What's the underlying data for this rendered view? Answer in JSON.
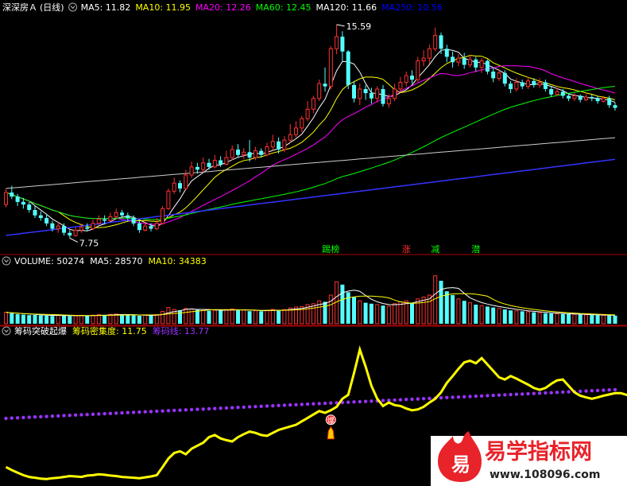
{
  "header": {
    "stock_name": "深深房Ａ",
    "period": "(日线)",
    "ma_items": [
      {
        "label": "MA5: 11.82",
        "color": "#ffffff"
      },
      {
        "label": "MA10: 11.95",
        "color": "#ffff00"
      },
      {
        "label": "MA20: 12.26",
        "color": "#ff00ff"
      },
      {
        "label": "MA60: 12.45",
        "color": "#00ff00"
      },
      {
        "label": "MA120: 11.66",
        "color": "#ffffff"
      },
      {
        "label": "MA250: 10.56",
        "color": "#0000ff"
      }
    ]
  },
  "annotations": {
    "high": "15.59",
    "low": "7.75"
  },
  "signals": [
    {
      "text": "踢榜",
      "color": "#00ff00",
      "bar": 56
    },
    {
      "text": "涨",
      "color": "#ff3030",
      "bar": 69
    },
    {
      "text": "减",
      "color": "#00ff00",
      "bar": 74
    },
    {
      "text": "潜",
      "color": "#00ff00",
      "bar": 81
    }
  ],
  "volume_header": {
    "items": [
      {
        "label": "VOLUME: 50274",
        "color": "#ffffff"
      },
      {
        "label": "MA5: 28570",
        "color": "#ffffff"
      },
      {
        "label": "MA10: 34383",
        "color": "#ffff00"
      }
    ]
  },
  "indicator_header": {
    "items": [
      {
        "label": "筹码突破起爆",
        "color": "#ffffff"
      },
      {
        "label": "筹码密集度: 11.75",
        "color": "#ffff00"
      },
      {
        "label": "筹码线: 13.77",
        "color": "#9933ff"
      }
    ]
  },
  "indicator_marker": "爆",
  "watermark": {
    "brand": "易学指标网",
    "url": "www.108096.com",
    "logo_char": "易"
  },
  "chart_data": {
    "type": "candlestick",
    "price_range": [
      7.2,
      16.2
    ],
    "volume_range": [
      0,
      60000
    ],
    "indicator_range": [
      0,
      35
    ],
    "candles": [
      [
        9.0,
        9.45,
        9.6,
        8.9
      ],
      [
        9.45,
        9.3,
        9.7,
        9.2
      ],
      [
        9.3,
        9.1,
        9.4,
        8.95
      ],
      [
        9.1,
        9.0,
        9.25,
        8.85
      ],
      [
        9.0,
        8.8,
        9.1,
        8.7
      ],
      [
        8.8,
        8.6,
        8.95,
        8.5
      ],
      [
        8.6,
        8.5,
        8.75,
        8.4
      ],
      [
        8.5,
        8.3,
        8.65,
        8.2
      ],
      [
        8.3,
        8.1,
        8.4,
        8.0
      ],
      [
        8.1,
        8.2,
        8.35,
        7.95
      ],
      [
        8.2,
        7.95,
        8.3,
        7.85
      ],
      [
        7.95,
        7.85,
        8.05,
        7.75
      ],
      [
        7.85,
        8.05,
        8.15,
        7.8
      ],
      [
        8.05,
        8.15,
        8.25,
        7.95
      ],
      [
        8.15,
        8.1,
        8.3,
        8.0
      ],
      [
        8.1,
        8.3,
        8.45,
        8.05
      ],
      [
        8.3,
        8.45,
        8.6,
        8.25
      ],
      [
        8.45,
        8.4,
        8.6,
        8.3
      ],
      [
        8.4,
        8.55,
        8.7,
        8.35
      ],
      [
        8.55,
        8.7,
        8.85,
        8.5
      ],
      [
        8.7,
        8.6,
        8.8,
        8.5
      ],
      [
        8.6,
        8.5,
        8.7,
        8.4
      ],
      [
        8.5,
        8.3,
        8.6,
        8.2
      ],
      [
        8.3,
        8.05,
        8.4,
        7.95
      ],
      [
        8.05,
        8.2,
        8.35,
        8.0
      ],
      [
        8.2,
        8.1,
        8.3,
        8.0
      ],
      [
        8.1,
        8.3,
        8.5,
        8.05
      ],
      [
        8.3,
        8.85,
        8.95,
        8.25
      ],
      [
        8.85,
        9.5,
        9.6,
        8.8
      ],
      [
        9.5,
        9.8,
        10.0,
        9.4
      ],
      [
        9.8,
        9.6,
        9.9,
        9.45
      ],
      [
        9.6,
        10.1,
        10.3,
        9.55
      ],
      [
        10.1,
        10.4,
        10.6,
        10.0
      ],
      [
        10.4,
        10.3,
        10.55,
        10.15
      ],
      [
        10.3,
        10.55,
        10.75,
        10.2
      ],
      [
        10.55,
        10.4,
        10.7,
        10.3
      ],
      [
        10.4,
        10.65,
        10.85,
        10.35
      ],
      [
        10.65,
        10.5,
        10.8,
        10.4
      ],
      [
        10.5,
        10.75,
        11.0,
        10.45
      ],
      [
        10.75,
        11.05,
        11.2,
        10.65
      ],
      [
        11.05,
        10.85,
        11.25,
        10.75
      ],
      [
        10.85,
        10.95,
        11.1,
        10.7
      ],
      [
        10.95,
        10.75,
        11.4,
        10.6
      ],
      [
        10.75,
        11.0,
        11.15,
        10.65
      ],
      [
        11.0,
        10.85,
        11.1,
        10.75
      ],
      [
        10.85,
        11.15,
        11.3,
        10.8
      ],
      [
        11.15,
        11.35,
        11.6,
        11.05
      ],
      [
        11.35,
        11.05,
        11.5,
        10.9
      ],
      [
        11.05,
        11.4,
        11.55,
        10.95
      ],
      [
        11.4,
        11.6,
        12.0,
        11.3
      ],
      [
        11.6,
        11.85,
        12.1,
        11.5
      ],
      [
        11.85,
        12.2,
        12.3,
        11.7
      ],
      [
        12.2,
        12.55,
        12.85,
        12.1
      ],
      [
        12.55,
        12.95,
        13.05,
        12.4
      ],
      [
        12.95,
        13.5,
        13.65,
        12.85
      ],
      [
        13.5,
        13.4,
        14.1,
        13.2
      ],
      [
        13.4,
        14.8,
        14.9,
        13.3
      ],
      [
        14.8,
        15.25,
        15.7,
        14.6
      ],
      [
        15.25,
        14.7,
        15.45,
        14.35
      ],
      [
        14.7,
        13.45,
        14.75,
        13.3
      ],
      [
        13.45,
        12.95,
        13.6,
        12.8
      ],
      [
        12.95,
        13.3,
        13.5,
        12.7
      ],
      [
        13.3,
        13.15,
        13.45,
        12.9
      ],
      [
        13.15,
        12.95,
        13.35,
        12.75
      ],
      [
        12.95,
        13.3,
        13.4,
        12.8
      ],
      [
        13.3,
        12.75,
        13.45,
        12.65
      ],
      [
        12.75,
        12.95,
        13.1,
        12.6
      ],
      [
        12.95,
        13.3,
        13.5,
        12.85
      ],
      [
        13.3,
        13.55,
        13.75,
        13.2
      ],
      [
        13.55,
        13.8,
        13.95,
        13.4
      ],
      [
        13.8,
        13.65,
        14.0,
        13.5
      ],
      [
        13.65,
        14.35,
        14.5,
        13.55
      ],
      [
        14.35,
        14.45,
        14.75,
        14.15
      ],
      [
        14.45,
        14.8,
        14.95,
        14.25
      ],
      [
        14.8,
        15.3,
        15.59,
        14.7
      ],
      [
        15.3,
        14.8,
        15.4,
        14.6
      ],
      [
        14.8,
        14.5,
        14.95,
        14.3
      ],
      [
        14.5,
        14.3,
        14.7,
        14.1
      ],
      [
        14.3,
        14.45,
        14.6,
        14.15
      ],
      [
        14.45,
        14.2,
        14.65,
        14.05
      ],
      [
        14.2,
        14.4,
        14.55,
        14.1
      ],
      [
        14.4,
        14.1,
        14.5,
        13.95
      ],
      [
        14.1,
        14.35,
        14.45,
        13.9
      ],
      [
        14.35,
        13.95,
        14.4,
        13.85
      ],
      [
        13.95,
        13.7,
        14.1,
        13.55
      ],
      [
        13.7,
        13.9,
        14.05,
        13.6
      ],
      [
        13.9,
        13.5,
        14.0,
        13.4
      ],
      [
        13.5,
        13.3,
        13.6,
        13.15
      ],
      [
        13.3,
        13.55,
        13.7,
        13.2
      ],
      [
        13.55,
        13.4,
        13.65,
        13.3
      ],
      [
        13.4,
        13.6,
        13.75,
        13.3
      ],
      [
        13.6,
        13.45,
        13.7,
        13.35
      ],
      [
        13.45,
        13.55,
        13.7,
        13.35
      ],
      [
        13.55,
        13.3,
        13.65,
        13.2
      ],
      [
        13.3,
        13.1,
        13.4,
        13.0
      ],
      [
        13.1,
        13.2,
        13.35,
        13.05
      ],
      [
        13.2,
        13.05,
        13.3,
        12.95
      ],
      [
        13.05,
        12.95,
        13.15,
        12.85
      ],
      [
        12.95,
        13.05,
        13.15,
        12.85
      ],
      [
        13.05,
        12.9,
        13.1,
        12.8
      ],
      [
        12.9,
        13.0,
        13.1,
        12.85
      ],
      [
        13.0,
        12.95,
        13.1,
        12.85
      ],
      [
        12.95,
        12.85,
        13.05,
        12.75
      ],
      [
        12.85,
        12.95,
        13.05,
        12.8
      ],
      [
        12.95,
        12.7,
        13.05,
        12.6
      ],
      [
        12.7,
        12.6,
        12.8,
        12.5
      ]
    ],
    "volumes": [
      12000,
      11000,
      10000,
      9500,
      9000,
      9200,
      8800,
      8500,
      8200,
      9000,
      8600,
      8000,
      8400,
      8800,
      8300,
      9000,
      9500,
      9200,
      9800,
      10200,
      9600,
      9000,
      8700,
      8400,
      9000,
      8800,
      9500,
      13000,
      17000,
      15000,
      14000,
      16000,
      15500,
      14500,
      15000,
      13500,
      14200,
      13800,
      14800,
      15600,
      14000,
      14500,
      13200,
      13800,
      13000,
      14200,
      15000,
      13500,
      14800,
      16500,
      17500,
      18000,
      20000,
      21000,
      24000,
      23000,
      30000,
      44000,
      41000,
      33000,
      28000,
      24000,
      22000,
      21000,
      20000,
      19000,
      18500,
      21000,
      23000,
      24000,
      22000,
      26000,
      28000,
      30000,
      50274,
      45000,
      34000,
      30000,
      26000,
      24000,
      22000,
      20000,
      19000,
      18000,
      17000,
      16000,
      15000,
      14000,
      13500,
      13000,
      12500,
      12000,
      11500,
      11000,
      10800,
      10500,
      10200,
      10000,
      9800,
      9500,
      9300,
      9100,
      9000,
      8800,
      8600,
      8500
    ],
    "indicator": [
      3.5,
      2.8,
      2.2,
      1.6,
      1.2,
      1.0,
      0.8,
      0.7,
      0.9,
      1.0,
      1.2,
      1.4,
      1.3,
      1.2,
      1.5,
      1.6,
      1.8,
      1.7,
      1.5,
      1.4,
      1.2,
      1.1,
      1.0,
      0.9,
      1.1,
      1.3,
      1.6,
      3.5,
      5.5,
      6.8,
      7.2,
      6.5,
      7.8,
      8.5,
      9.2,
      10.5,
      11.0,
      10.2,
      9.8,
      9.5,
      10.5,
      11.2,
      11.8,
      11.5,
      11.0,
      10.8,
      11.5,
      12.2,
      12.6,
      13.0,
      13.4,
      14.2,
      15.0,
      15.8,
      16.6,
      16.2,
      16.8,
      17.6,
      19.5,
      20.4,
      25.5,
      31.0,
      27.0,
      22.5,
      19.5,
      17.8,
      18.6,
      18.0,
      17.8,
      17.2,
      16.8,
      17.0,
      17.6,
      18.6,
      19.5,
      21.0,
      23.2,
      24.8,
      26.5,
      28.0,
      28.4,
      27.8,
      29.0,
      27.5,
      26.0,
      24.5,
      24.0,
      24.8,
      24.2,
      23.5,
      22.8,
      22.0,
      21.6,
      22.0,
      23.0,
      23.8,
      24.0,
      22.5,
      21.0,
      20.2,
      19.8,
      19.5,
      19.8,
      20.2,
      20.5,
      20.8,
      20.8,
      20.4,
      20.0,
      19.8,
      20.2,
      20.6
    ]
  }
}
